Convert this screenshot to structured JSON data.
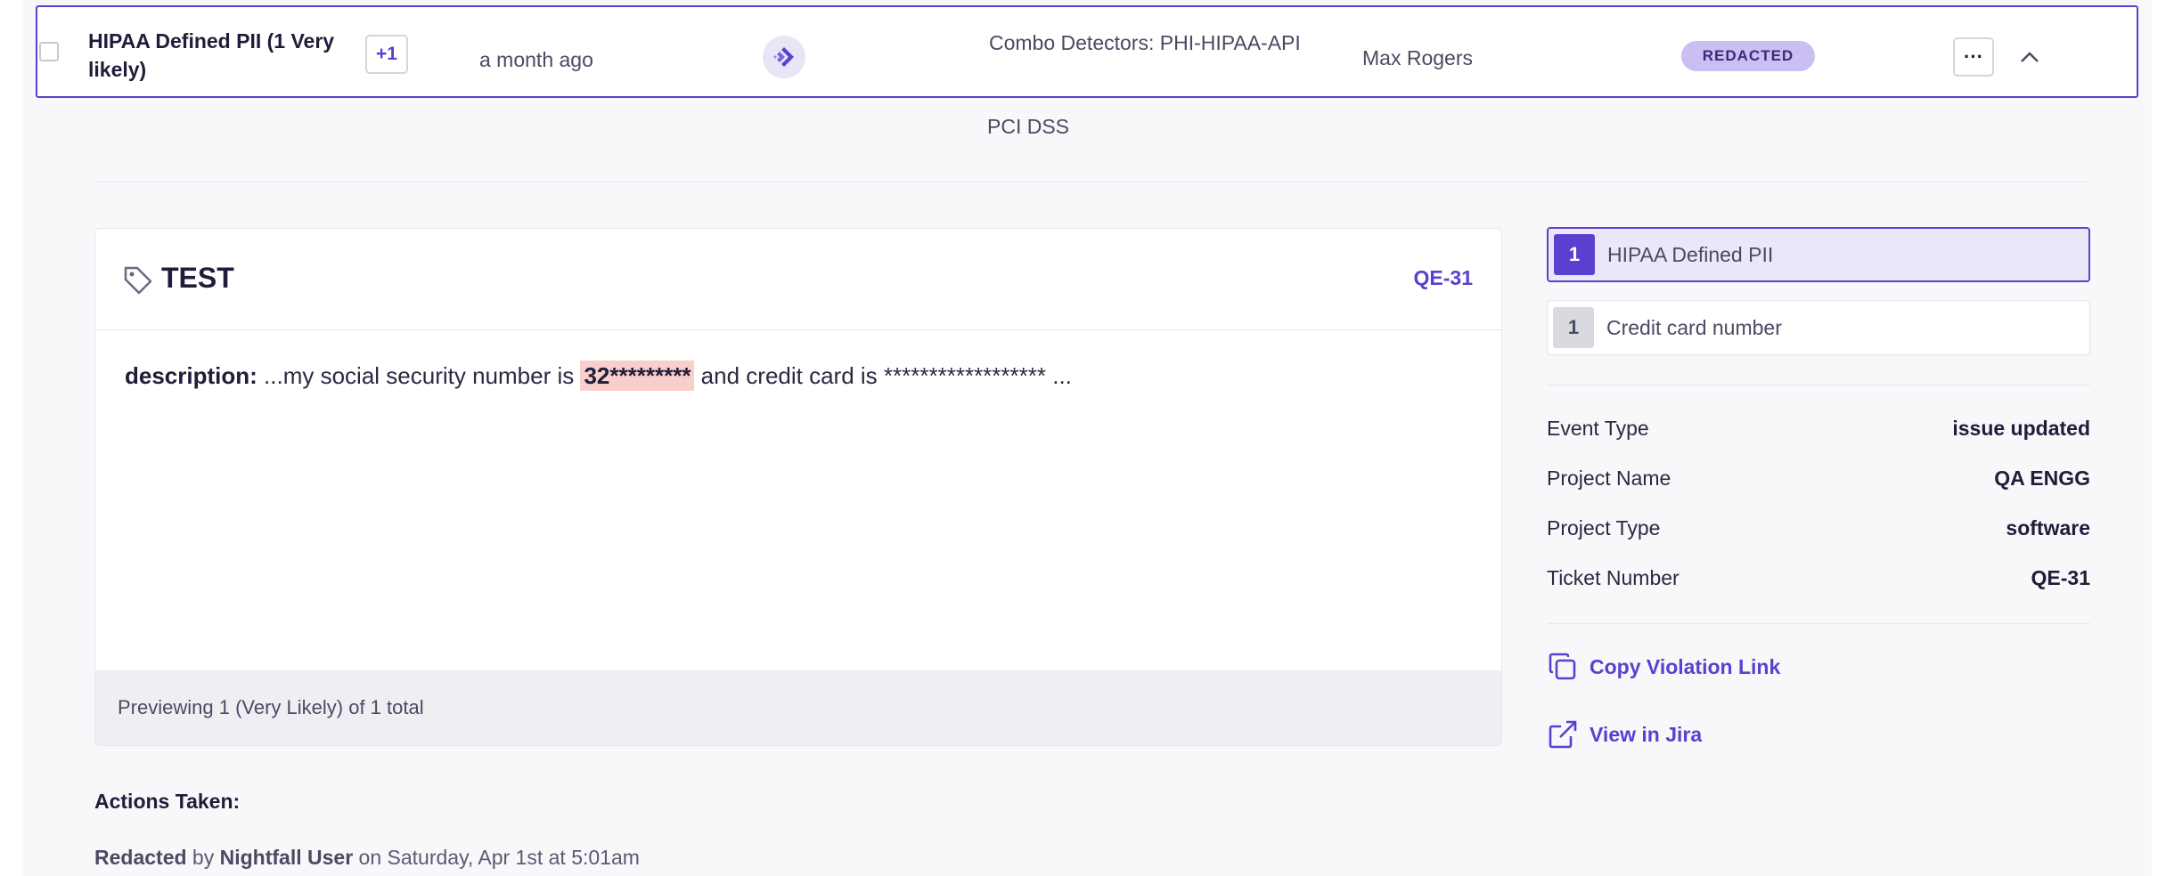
{
  "row": {
    "issue_title": "HIPAA Defined PII (1 Very likely)",
    "extra_count": "+1",
    "time_ago": "a month ago",
    "integration_icon": "jira-icon",
    "detector": "Combo Detectors: PHI-HIPAA-API",
    "user": "Max Rogers",
    "status": "REDACTED",
    "more_label": "···",
    "secondary_policy": "PCI DSS"
  },
  "preview": {
    "title": "TEST",
    "ticket": "QE-31",
    "desc_label": "description:",
    "desc_before": "...my social security number is ",
    "desc_match": "32*********",
    "desc_after": " and credit card is ****************** ...",
    "footer": "Previewing 1 (Very Likely) of 1 total"
  },
  "actions": {
    "title": "Actions Taken:",
    "action": "Redacted",
    "by": " by ",
    "actor": "Nightfall User",
    "on": " on Saturday, Apr 1st at 5:01am"
  },
  "findings": [
    {
      "count": "1",
      "name": "HIPAA Defined PII"
    },
    {
      "count": "1",
      "name": "Credit card number"
    }
  ],
  "meta": [
    {
      "key": "Event Type",
      "value": "issue updated"
    },
    {
      "key": "Project Name",
      "value": "QA ENGG"
    },
    {
      "key": "Project Type",
      "value": "software"
    },
    {
      "key": "Ticket Number",
      "value": "QE-31"
    }
  ],
  "links": {
    "copy": "Copy Violation Link",
    "view": "View in Jira"
  },
  "colors": {
    "accent": "#5b3fd1",
    "badge_bg": "#cbbef2",
    "highlight": "#f8cfcc"
  }
}
